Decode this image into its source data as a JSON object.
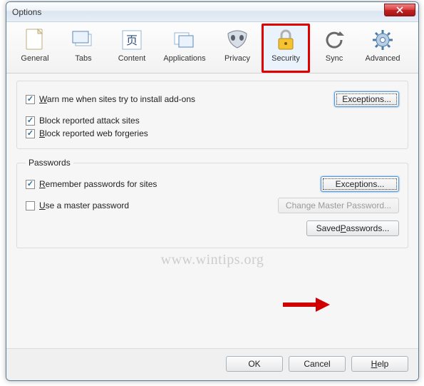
{
  "window": {
    "title": "Options"
  },
  "toolbar": {
    "items": [
      {
        "label": "General"
      },
      {
        "label": "Tabs"
      },
      {
        "label": "Content"
      },
      {
        "label": "Applications"
      },
      {
        "label": "Privacy"
      },
      {
        "label": "Security"
      },
      {
        "label": "Sync"
      },
      {
        "label": "Advanced"
      }
    ],
    "selected_index": 5
  },
  "security": {
    "warn_addons": {
      "checked": true,
      "pre": "W",
      "post": "arn me when sites try to install add-ons"
    },
    "block_attack": {
      "checked": true,
      "pre": "",
      "post": "Block reported attack sites"
    },
    "block_forgeries": {
      "checked": true,
      "pre": "B",
      "post": "lock reported web forgeries"
    },
    "exceptions_label": "Exceptions..."
  },
  "passwords": {
    "legend": "Passwords",
    "remember": {
      "checked": true,
      "pre": "R",
      "post": "emember passwords for sites"
    },
    "master": {
      "checked": false,
      "pre": "U",
      "post": "se a master password"
    },
    "exceptions_label": "Exceptions...",
    "change_master_label": "Change Master Password...",
    "saved_label_pre": "Saved ",
    "saved_label_u": "P",
    "saved_label_post": "asswords..."
  },
  "footer": {
    "ok": "OK",
    "cancel": "Cancel",
    "help_u": "H",
    "help_post": "elp"
  },
  "watermark": "www.wintips.org"
}
